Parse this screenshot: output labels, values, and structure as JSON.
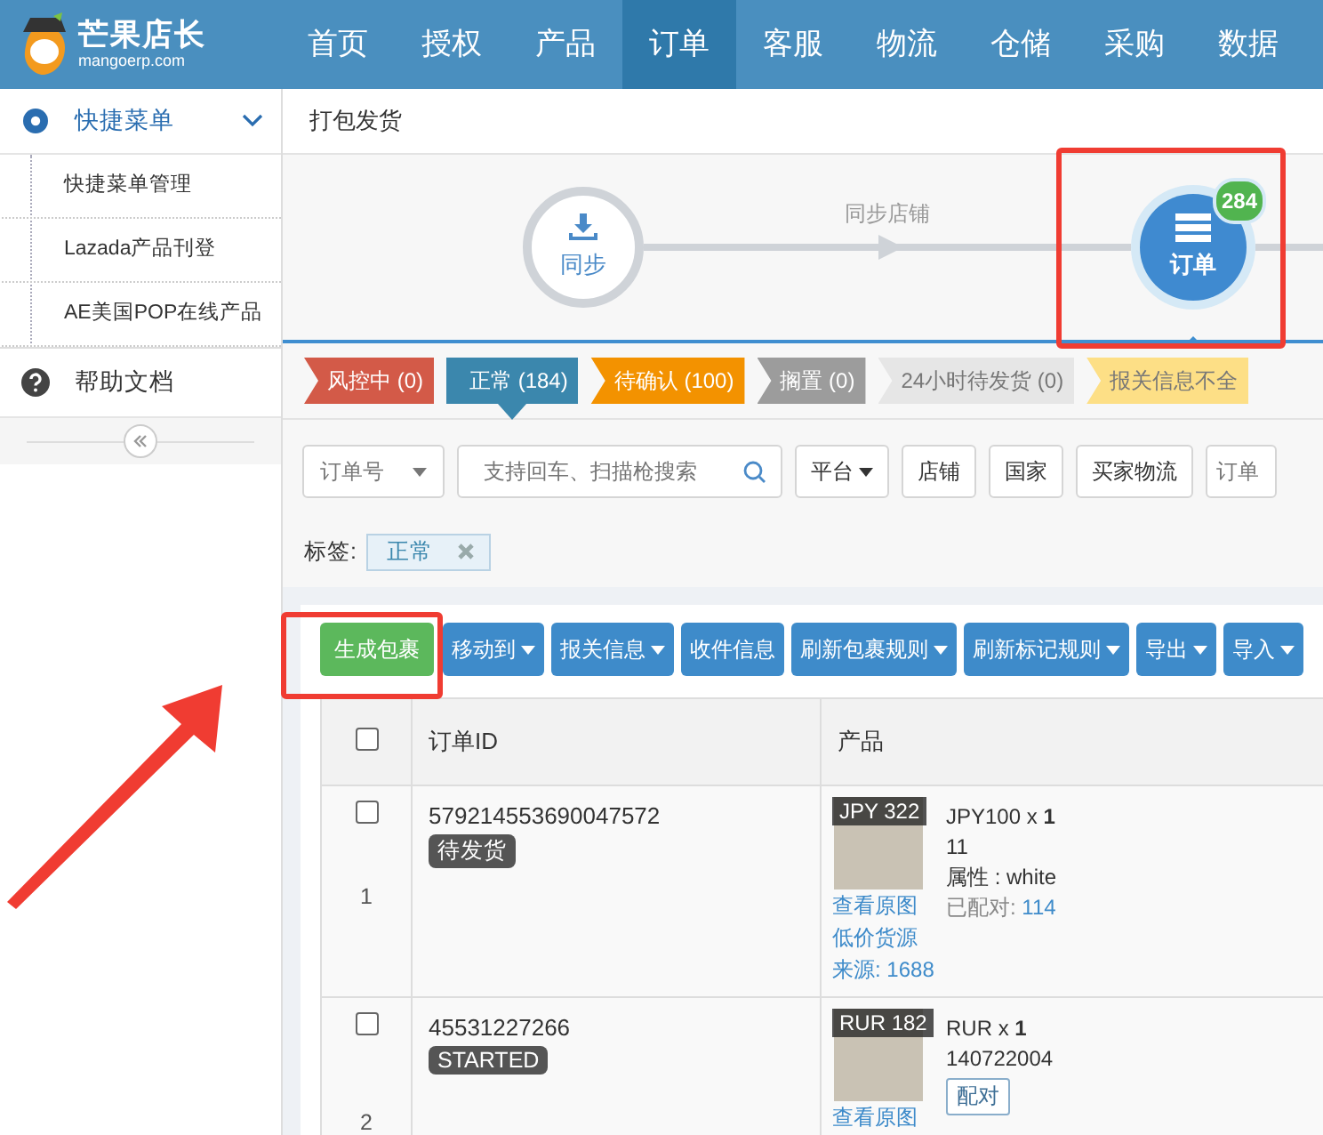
{
  "logo": {
    "name": "芒果店长",
    "domain": "mangoerp.com"
  },
  "nav": [
    {
      "label": "首页",
      "selected": false
    },
    {
      "label": "授权",
      "selected": false
    },
    {
      "label": "产品",
      "selected": false
    },
    {
      "label": "订单",
      "selected": true
    },
    {
      "label": "客服",
      "selected": false
    },
    {
      "label": "物流",
      "selected": false
    },
    {
      "label": "仓储",
      "selected": false
    },
    {
      "label": "采购",
      "selected": false
    },
    {
      "label": "数据",
      "selected": false
    }
  ],
  "sidebar": {
    "header": {
      "label": "快捷菜单",
      "expanded": true
    },
    "items": [
      "快捷菜单管理",
      "Lazada产品刊登",
      "AE美国POP在线产品"
    ],
    "help": "帮助文档"
  },
  "breadcrumb": "打包发货",
  "flow": {
    "connector_label": "同步店铺",
    "nodes": [
      {
        "kind": "sync",
        "label": "同步"
      },
      {
        "kind": "orders",
        "label": "订单",
        "badge": "284"
      }
    ]
  },
  "status_tabs": [
    {
      "label": "风控中 (0)",
      "color": "#d35a48",
      "selected": false
    },
    {
      "label": "正常 (184)",
      "color": "#3b87ad",
      "selected": true
    },
    {
      "label": "待确认 (100)",
      "color": "#f39200",
      "selected": false
    },
    {
      "label": "搁置 (0)",
      "color": "#9c9c9c",
      "selected": false
    },
    {
      "label": "24小时待发货 (0)",
      "color": "#e6e6e6",
      "selected": false
    },
    {
      "label": "报关信息不全",
      "color": "#fddf86",
      "selected": false
    }
  ],
  "filters": {
    "select": "订单号",
    "search_placeholder": "支持回车、扫描枪搜索",
    "buttons": [
      {
        "label": "平台",
        "dropdown": true
      },
      {
        "label": "店铺",
        "dropdown": false
      },
      {
        "label": "国家",
        "dropdown": false
      },
      {
        "label": "买家物流",
        "dropdown": false
      }
    ],
    "extra_placeholder": "订单"
  },
  "tags": {
    "label": "标签:",
    "items": [
      "正常"
    ]
  },
  "toolbar": [
    {
      "label": "生成包裹",
      "kind": "success",
      "dropdown": false
    },
    {
      "label": "移动到",
      "kind": "primary",
      "dropdown": true
    },
    {
      "label": "报关信息",
      "kind": "primary",
      "dropdown": true
    },
    {
      "label": "收件信息",
      "kind": "primary",
      "dropdown": false
    },
    {
      "label": "刷新包裹规则",
      "kind": "primary",
      "dropdown": true
    },
    {
      "label": "刷新标记规则",
      "kind": "primary",
      "dropdown": true
    },
    {
      "label": "导出",
      "kind": "primary",
      "dropdown": true
    },
    {
      "label": "导入",
      "kind": "primary",
      "dropdown": true
    }
  ],
  "table": {
    "columns": [
      "订单ID",
      "产品"
    ],
    "header_checked": false,
    "rows": [
      {
        "index": "1",
        "checked": false,
        "order_id": "579214553690047572",
        "status": "待发货",
        "price_tag": "JPY 322",
        "sku": "JPY100 x **1**",
        "lines": [
          "11",
          "属性 : white"
        ],
        "paired": {
          "label": "已配对:",
          "value": "114"
        },
        "pair_button": null,
        "links": [
          "查看原图",
          "低价货源"
        ],
        "source": {
          "label": "来源:",
          "value": "1688"
        }
      },
      {
        "index": "2",
        "checked": false,
        "order_id": "45531227266",
        "status": "STARTED",
        "price_tag": "RUR 182",
        "sku": "RUR x **1**",
        "lines": [
          "140722004"
        ],
        "paired": null,
        "pair_button": "配对",
        "links": [
          "查看原图"
        ],
        "source": null
      }
    ]
  }
}
